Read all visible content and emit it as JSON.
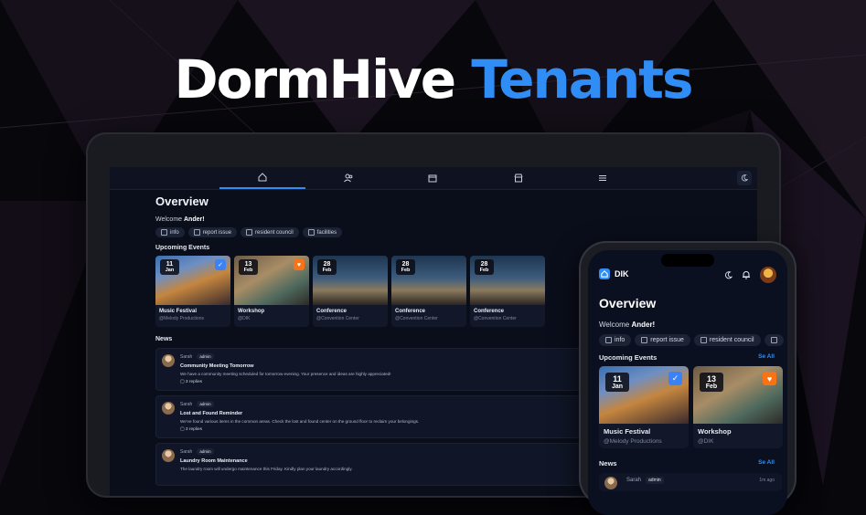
{
  "hero": {
    "word1": "DormHive",
    "word2": "Tenants"
  },
  "colors": {
    "accent": "#2f8df5",
    "background": "#0a0e1a",
    "festival_badge": "#3b82f6",
    "workshop_badge": "#f97316"
  },
  "desktop": {
    "nav": {
      "tabs": [
        {
          "icon": "home-icon",
          "active": true
        },
        {
          "icon": "users-icon",
          "active": false
        },
        {
          "icon": "calendar-icon",
          "active": false
        },
        {
          "icon": "store-icon",
          "active": false
        },
        {
          "icon": "menu-icon",
          "active": false
        }
      ],
      "theme_icon": "moon-icon"
    },
    "title": "Overview",
    "welcome_prefix": "Welcome",
    "user": "Ander!",
    "chips": [
      "info",
      "report issue",
      "resident council",
      "facilities"
    ],
    "upcoming_label": "Upcoming Events",
    "events": [
      {
        "day": "11",
        "month": "Jan",
        "title": "Music Festival",
        "org": "@Melody Productions",
        "badge": "check-icon"
      },
      {
        "day": "13",
        "month": "Feb",
        "title": "Workshop",
        "org": "@DIK",
        "badge": "heart-icon"
      },
      {
        "day": "28",
        "month": "Feb",
        "title": "Conference",
        "org": "@Convention Center"
      },
      {
        "day": "28",
        "month": "Feb",
        "title": "Conference",
        "org": "@Convention Center"
      },
      {
        "day": "28",
        "month": "Feb",
        "title": "Conference",
        "org": "@Convention Center"
      }
    ],
    "news_label": "News",
    "posts": [
      {
        "author": "Sarah",
        "role": "admin",
        "title": "Community Meeting Tomorrow",
        "body": "We have a community meeting scheduled for tomorrow evening. Your presence and ideas are highly appreciated!",
        "replies": "3 replies"
      },
      {
        "author": "Sarah",
        "role": "admin",
        "title": "Lost and Found Reminder",
        "body": "We've found various items in the common areas. Check the lost and found center on the ground floor to reclaim your belongings.",
        "replies": "3 replies"
      },
      {
        "author": "Sarah",
        "role": "admin",
        "title": "Laundry Room Maintenance",
        "body": "The laundry room will undergo maintenance this Friday. Kindly plan your laundry accordingly.",
        "replies": ""
      }
    ]
  },
  "mobile": {
    "brand": "DIK",
    "title": "Overview",
    "welcome_prefix": "Welcome",
    "user": "Ander!",
    "chips": [
      "info",
      "report issue",
      "resident council"
    ],
    "upcoming_label": "Upcoming Events",
    "see_all": "Se All",
    "events": [
      {
        "day": "11",
        "month": "Jan",
        "title": "Music Festival",
        "org": "@Melody Productions"
      },
      {
        "day": "13",
        "month": "Feb",
        "title": "Workshop",
        "org": "@DIK"
      }
    ],
    "news_label": "News",
    "news_see_all": "Se All",
    "post": {
      "author": "Sarah",
      "role": "admin",
      "time": "1m ago"
    }
  }
}
